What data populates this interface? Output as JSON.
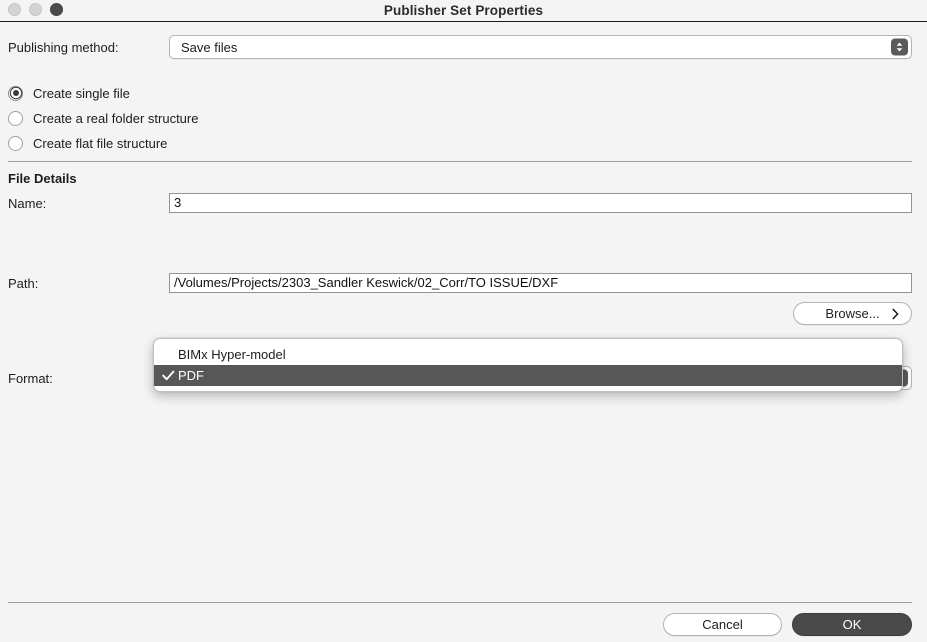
{
  "window": {
    "title": "Publisher Set Properties",
    "traffic_lights": [
      {
        "name": "close-button",
        "state": "disabled"
      },
      {
        "name": "minimize-button",
        "state": "disabled"
      },
      {
        "name": "zoom-button",
        "state": "active"
      }
    ]
  },
  "publishing_method": {
    "label": "Publishing method:",
    "value": "Save files"
  },
  "structure_options": [
    {
      "label": "Create single file",
      "checked": true
    },
    {
      "label": "Create a real folder structure",
      "checked": false
    },
    {
      "label": "Create flat file structure",
      "checked": false
    }
  ],
  "file_details": {
    "heading": "File Details",
    "name": {
      "label": "Name:",
      "value": "3"
    },
    "path": {
      "label": "Path:",
      "value": "/Volumes/Projects/2303_Sandler Keswick/02_Corr/TO ISSUE/DXF"
    },
    "browse": {
      "label": "Browse..."
    },
    "format": {
      "label": "Format:",
      "value": "PDF"
    }
  },
  "format_menu": {
    "items": [
      {
        "label": "BIMx Hyper-model",
        "selected": false
      },
      {
        "label": "PDF",
        "selected": true
      }
    ]
  },
  "footer": {
    "cancel_label": "Cancel",
    "ok_label": "OK"
  },
  "colors": {
    "background": "#f4f4f4",
    "default_button": "#4a4a4a",
    "menu_highlight": "#575757",
    "separator": "#9d9d9d"
  }
}
